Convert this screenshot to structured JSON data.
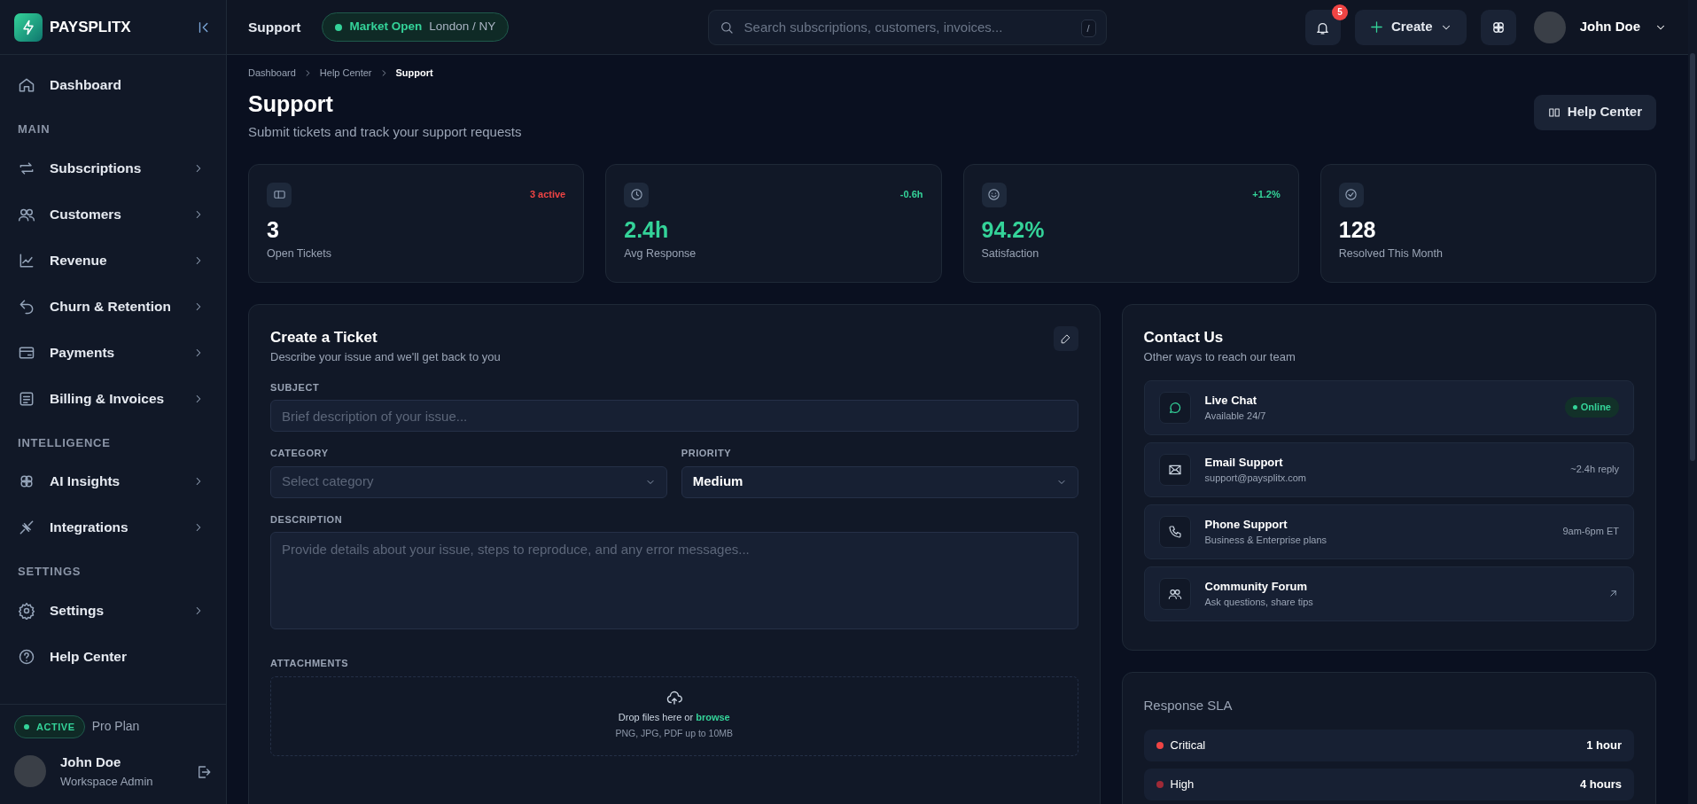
{
  "sidebar": {
    "brand": "PAYSPLITX",
    "items": [
      {
        "kind": "link",
        "label": "Dashboard",
        "has_submenu": false
      },
      {
        "kind": "heading",
        "label": "MAIN"
      },
      {
        "kind": "link",
        "label": "Subscriptions",
        "has_submenu": true
      },
      {
        "kind": "link",
        "label": "Customers",
        "has_submenu": true
      },
      {
        "kind": "link",
        "label": "Revenue",
        "has_submenu": true
      },
      {
        "kind": "link",
        "label": "Churn & Retention",
        "has_submenu": true
      },
      {
        "kind": "link",
        "label": "Payments",
        "has_submenu": true
      },
      {
        "kind": "link",
        "label": "Billing & Invoices",
        "has_submenu": true
      },
      {
        "kind": "heading",
        "label": "INTELLIGENCE"
      },
      {
        "kind": "link",
        "label": "AI Insights",
        "has_submenu": true
      },
      {
        "kind": "link",
        "label": "Integrations",
        "has_submenu": true
      },
      {
        "kind": "heading",
        "label": "SETTINGS"
      },
      {
        "kind": "link",
        "label": "Settings",
        "has_submenu": true
      },
      {
        "kind": "link",
        "label": "Help Center",
        "has_submenu": false
      }
    ],
    "plan": {
      "status": "ACTIVE",
      "name": "Pro Plan"
    },
    "user": {
      "name": "John Doe",
      "role": "Workspace Admin"
    }
  },
  "topbar": {
    "title": "Support",
    "market": {
      "status": "Market Open",
      "location": "London / NY"
    },
    "search": {
      "placeholder": "Search subscriptions, customers, invoices...",
      "shortcut": "/"
    },
    "notifications": "5",
    "create": "Create",
    "user": "John Doe"
  },
  "breadcrumb": [
    {
      "label": "Dashboard",
      "current": false
    },
    {
      "label": "Help Center",
      "current": false
    },
    {
      "label": "Support",
      "current": true
    }
  ],
  "header": {
    "title": "Support",
    "subtitle": "Submit tickets and track your support requests",
    "button": "Help Center"
  },
  "stats": [
    {
      "label": "Open Tickets",
      "value": "3",
      "delta": "3 active",
      "delta_negative": true,
      "value_highlighted": false
    },
    {
      "label": "Avg Response",
      "value": "2.4h",
      "delta": "-0.6h",
      "delta_negative": false,
      "value_highlighted": true
    },
    {
      "label": "Satisfaction",
      "value": "94.2%",
      "delta": "+1.2%",
      "delta_negative": false,
      "value_highlighted": true
    },
    {
      "label": "Resolved This Month",
      "value": "128",
      "value_highlighted": false
    }
  ],
  "ticket_form": {
    "title": "Create a Ticket",
    "subtitle": "Describe your issue and we'll get back to you",
    "fields": [
      {
        "kind": "text",
        "label": "SUBJECT",
        "placeholder": "Brief description of your issue..."
      },
      {
        "kind": "select",
        "label": "CATEGORY",
        "placeholder": "Select category"
      },
      {
        "kind": "select",
        "label": "PRIORITY",
        "value": "Medium"
      },
      {
        "kind": "textarea",
        "label": "DESCRIPTION",
        "placeholder": "Provide details about your issue, steps to reproduce, and any error messages..."
      }
    ],
    "attachments": {
      "label": "ATTACHMENTS",
      "text": "Drop files here or",
      "link": "browse",
      "hint": "PNG, JPG, PDF up to 10MB"
    }
  },
  "contact": {
    "title": "Contact Us",
    "subtitle": "Other ways to reach our team",
    "channels": [
      {
        "kind": "badge",
        "name": "Live Chat",
        "detail": "Available 24/7",
        "meta": "Online"
      },
      {
        "kind": "text",
        "name": "Email Support",
        "detail": "support@paysplitx.com",
        "meta": "~2.4h reply"
      },
      {
        "kind": "text",
        "name": "Phone Support",
        "detail": "Business & Enterprise plans",
        "meta": "9am-6pm ET"
      },
      {
        "kind": "external",
        "name": "Community Forum",
        "detail": "Ask questions, share tips"
      }
    ]
  },
  "sla": {
    "title": "Response SLA",
    "rows": [
      {
        "priority": "Critical",
        "time": "1 hour",
        "color": "#ef4444"
      },
      {
        "priority": "High",
        "time": "4 hours",
        "color": "#9f2a37"
      }
    ]
  }
}
